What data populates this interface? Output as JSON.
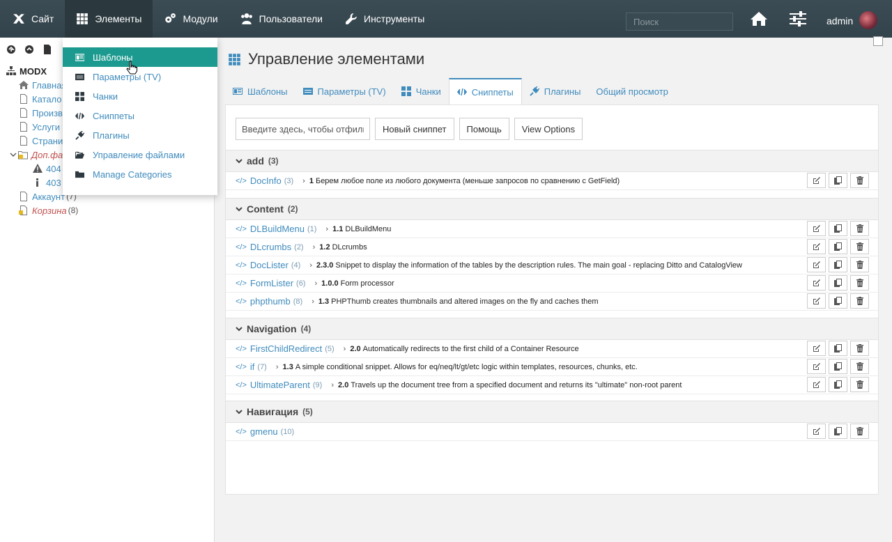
{
  "nav": {
    "items": [
      {
        "label": "Сайт",
        "icon": "site-icon"
      },
      {
        "label": "Элементы",
        "icon": "grid-icon"
      },
      {
        "label": "Модули",
        "icon": "gears-icon"
      },
      {
        "label": "Пользователи",
        "icon": "users-icon"
      },
      {
        "label": "Инструменты",
        "icon": "wrench-icon"
      }
    ],
    "search_placeholder": "Поиск",
    "user": "admin"
  },
  "tree": {
    "root": "MODX",
    "items": [
      {
        "label": "Главная",
        "icon": "home-icon"
      },
      {
        "label": "Катало",
        "icon": "file-icon"
      },
      {
        "label": "Произв",
        "icon": "file-icon"
      },
      {
        "label": "Услуги",
        "icon": "file-icon"
      },
      {
        "label": "Страни",
        "icon": "file-icon"
      },
      {
        "label": "Доп.фа",
        "icon": "locked-folder-icon"
      },
      {
        "label": "404",
        "icon": "warning-icon"
      },
      {
        "label": "403",
        "icon": "info-icon"
      },
      {
        "label": "Аккаунт",
        "count": "(7)",
        "icon": "file-icon"
      },
      {
        "label": "Корзина",
        "count": "(8)",
        "icon": "locked-file-icon"
      }
    ]
  },
  "dropdown": {
    "items": [
      {
        "label": "Шаблоны",
        "icon": "template-icon"
      },
      {
        "label": "Параметры (TV)",
        "icon": "tv-icon"
      },
      {
        "label": "Чанки",
        "icon": "chunks-icon"
      },
      {
        "label": "Сниппеты",
        "icon": "code-icon"
      },
      {
        "label": "Плагины",
        "icon": "plug-icon"
      },
      {
        "label": "Управление файлами",
        "icon": "folder-open-icon"
      },
      {
        "label": "Manage Categories",
        "icon": "folder-icon"
      }
    ]
  },
  "main": {
    "title": "Управление элементами",
    "tabs": [
      {
        "label": "Шаблоны"
      },
      {
        "label": "Параметры (TV)"
      },
      {
        "label": "Чанки"
      },
      {
        "label": "Сниппеты"
      },
      {
        "label": "Плагины"
      },
      {
        "label": "Общий просмотр"
      }
    ],
    "filter_placeholder": "Введите здесь, чтобы отфильтровать",
    "buttons": {
      "new": "Новый сниппет",
      "help": "Помощь",
      "view": "View Options"
    },
    "categories": [
      {
        "name": "add",
        "count": "(3)",
        "rows": [
          {
            "name": "DocInfo",
            "id": "(3)",
            "ver": "1",
            "desc": "Берем любое поле из любого документа (меньше запросов по сравнению с GetField)"
          }
        ]
      },
      {
        "name": "Content",
        "count": "(2)",
        "rows": [
          {
            "name": "DLBuildMenu",
            "id": "(1)",
            "ver": "1.1",
            "desc": "DLBuildMenu"
          },
          {
            "name": "DLcrumbs",
            "id": "(2)",
            "ver": "1.2",
            "desc": "DLcrumbs"
          },
          {
            "name": "DocLister",
            "id": "(4)",
            "ver": "2.3.0",
            "desc": "Snippet to display the information of the tables by the description rules. The main goal - replacing Ditto and CatalogView"
          },
          {
            "name": "FormLister",
            "id": "(6)",
            "ver": "1.0.0",
            "desc": "Form processor"
          },
          {
            "name": "phpthumb",
            "id": "(8)",
            "ver": "1.3",
            "desc": "PHPThumb creates thumbnails and altered images on the fly and caches them"
          }
        ]
      },
      {
        "name": "Navigation",
        "count": "(4)",
        "rows": [
          {
            "name": "FirstChildRedirect",
            "id": "(5)",
            "ver": "2.0",
            "desc": "Automatically redirects to the first child of a Container Resource"
          },
          {
            "name": "if",
            "id": "(7)",
            "ver": "1.3",
            "desc": "A simple conditional snippet. Allows for eq/neq/lt/gt/etc logic within templates, resources, chunks, etc."
          },
          {
            "name": "UltimateParent",
            "id": "(9)",
            "ver": "2.0",
            "desc": "Travels up the document tree from a specified document and returns its \"ultimate\" non-root parent"
          }
        ]
      },
      {
        "name": "Навигация",
        "count": "(5)",
        "rows": [
          {
            "name": "gmenu",
            "id": "(10)",
            "ver": "",
            "desc": ""
          }
        ]
      }
    ]
  }
}
